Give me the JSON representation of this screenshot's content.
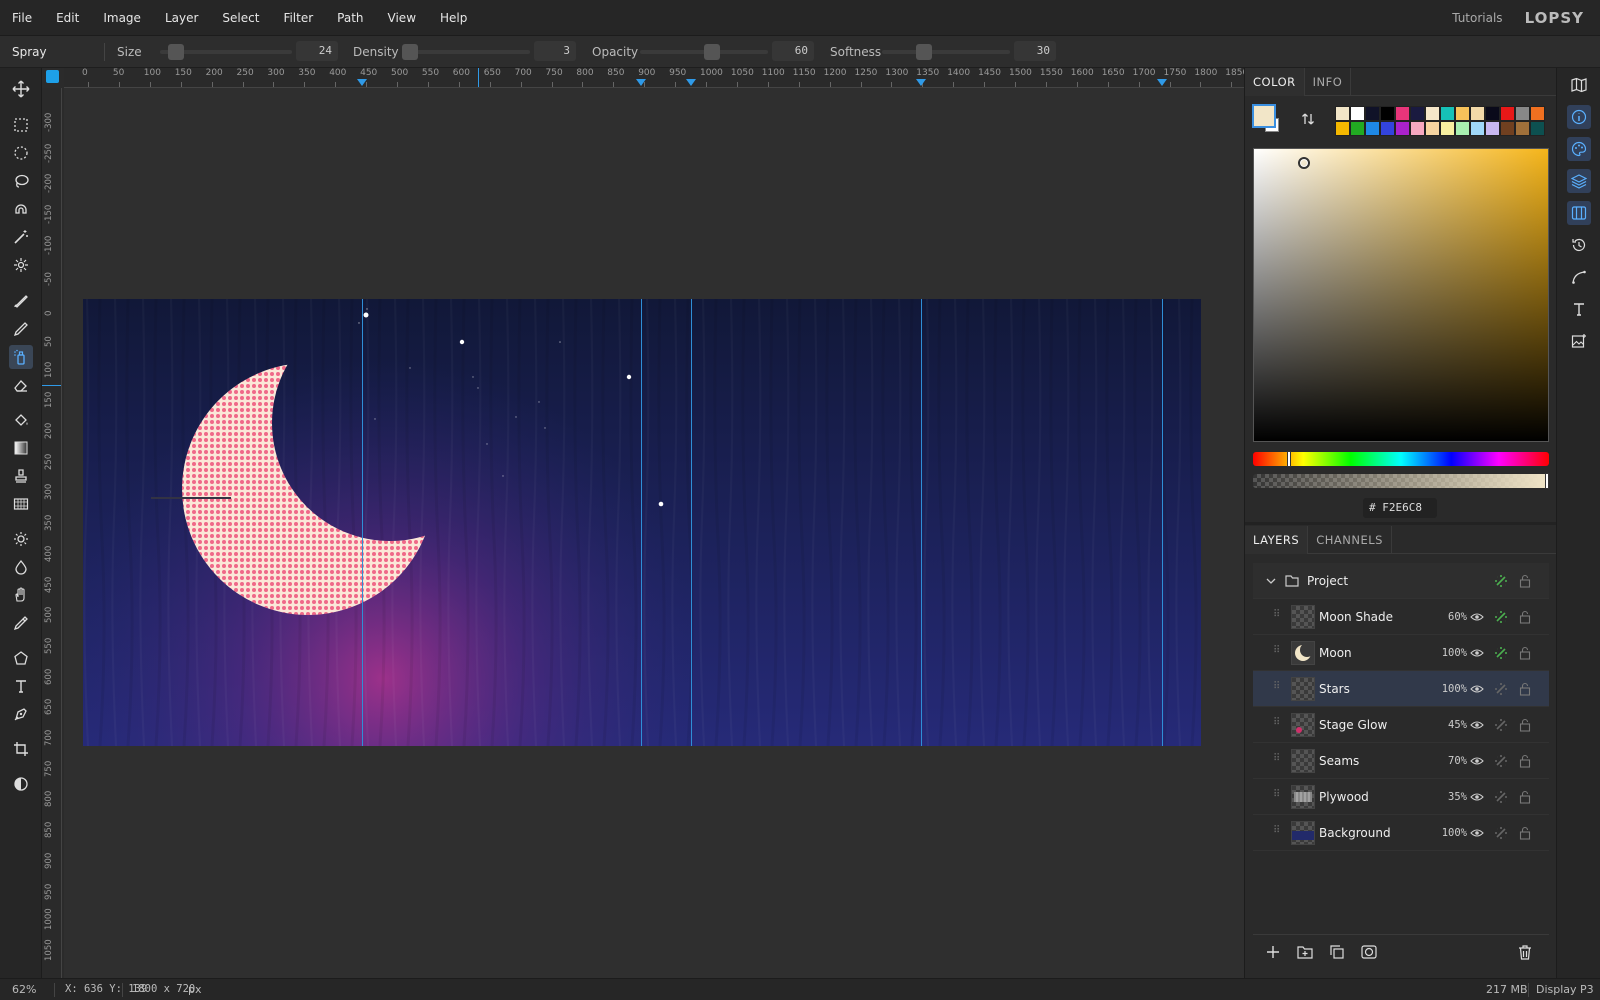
{
  "menu": {
    "items": [
      "File",
      "Edit",
      "Image",
      "Layer",
      "Select",
      "Filter",
      "Path",
      "View",
      "Help"
    ],
    "tutorials": "Tutorials",
    "logo": "LOPSY"
  },
  "options": {
    "tool_name": "Spray",
    "size_label": "Size",
    "size_value": "24",
    "density_label": "Density",
    "density_value": "3",
    "opacity_label": "Opacity",
    "opacity_value": "60",
    "softness_label": "Softness",
    "softness_value": "30"
  },
  "rulers": {
    "top": [
      "0",
      "50",
      "100",
      "150",
      "200",
      "250",
      "300",
      "350",
      "400",
      "450",
      "500",
      "550",
      "600",
      "650",
      "700",
      "750",
      "800",
      "850",
      "900",
      "950",
      "1000",
      "1050",
      "1100",
      "1150",
      "1200",
      "1250",
      "1300",
      "1350",
      "1400",
      "1450",
      "1500",
      "1550",
      "1600",
      "1650",
      "1700",
      "1750",
      "1800",
      "1850"
    ],
    "left": [
      "-300",
      "-250",
      "-200",
      "-150",
      "-100",
      "-50",
      "0",
      "50",
      "100",
      "150",
      "200",
      "250",
      "300",
      "350",
      "400",
      "450",
      "500",
      "550",
      "600",
      "650",
      "700",
      "750",
      "800",
      "850",
      "900",
      "950",
      "1000",
      "1050"
    ]
  },
  "tools": [
    "move-tool",
    "rect-select-tool",
    "ellipse-select-tool",
    "lasso-tool",
    "magnetic-lasso-tool",
    "magic-wand-tool",
    "quick-select-tool",
    "brush-tool",
    "pencil-tool",
    "spray-tool",
    "eraser-tool",
    "fill-tool",
    "gradient-tool",
    "stamp-tool",
    "pattern-tool",
    "brightness-tool",
    "blur-tool",
    "smudge-tool",
    "eyedropper-tool",
    "shape-tool",
    "text-tool",
    "pen-tool",
    "crop-tool",
    "contrast-tool"
  ],
  "color_panel": {
    "tab_color": "COLOR",
    "tab_info": "INFO",
    "foreground": "#F2E6C8",
    "background": "#FFFFFF",
    "swatches": [
      "#f2e6c8",
      "#ffffff",
      "#101228",
      "#000000",
      "#e8357a",
      "#1a1a40",
      "#f6e7c9",
      "#16c1b7",
      "#f7c25a",
      "#f2d9a8",
      "#0a0a1a",
      "#e81818",
      "#888888",
      "#f07020",
      "#f5b800",
      "#22aa22",
      "#1e88e5",
      "#3344dd",
      "#aa22cc",
      "#f7a8c0",
      "#f6d4a0",
      "#f8f0a0",
      "#a8f0b0",
      "#a0d8f8",
      "#c8b8f0",
      "#704020",
      "#a0703a",
      "#0d5050"
    ],
    "hex_prefix": "#",
    "hex_value": "F2E6C8"
  },
  "layers_panel": {
    "tab_layers": "LAYERS",
    "tab_channels": "CHANNELS",
    "group_name": "Project",
    "layers": [
      {
        "name": "Moon Shade",
        "opacity": "60%",
        "thumb": "checker",
        "fx": true
      },
      {
        "name": "Moon",
        "opacity": "100%",
        "thumb": "moon",
        "fx": true
      },
      {
        "name": "Stars",
        "opacity": "100%",
        "thumb": "checker",
        "fx": false
      },
      {
        "name": "Stage Glow",
        "opacity": "45%",
        "thumb": "glow",
        "fx": false
      },
      {
        "name": "Seams",
        "opacity": "70%",
        "thumb": "checker",
        "fx": false
      },
      {
        "name": "Plywood",
        "opacity": "35%",
        "thumb": "plywood",
        "fx": false
      },
      {
        "name": "Background",
        "opacity": "100%",
        "thumb": "navy",
        "fx": false
      }
    ],
    "selected_layer": "Stars"
  },
  "status": {
    "zoom": "62%",
    "coords_label": "X: 636 Y: 139",
    "dims": "1800 x 720",
    "dims_unit": "px",
    "memory": "217 MB",
    "color_profile": "Display P3"
  }
}
